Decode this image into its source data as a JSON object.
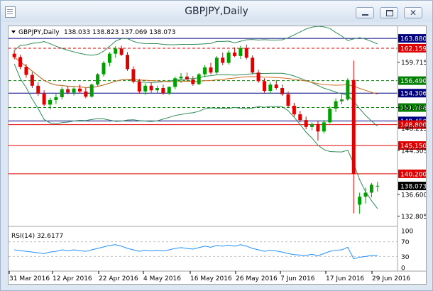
{
  "window": {
    "title": "GBPJPY,Daily",
    "icon": "chart-document-icon",
    "controls": {
      "minimize": "minimize-icon",
      "maximize": "maximize-icon",
      "close": "close-icon"
    },
    "close_glyph": "✕"
  },
  "chart_data": [
    {
      "type": "candlestick",
      "symbol": "GBPJPY,Daily",
      "ohlc_label": "138.033 138.823 137.069 138.073",
      "y_ticks": [
        "159.715",
        "151.784",
        "148.215",
        "144.305",
        "136.600",
        "132.805"
      ],
      "ylim": [
        131.0,
        166.0
      ],
      "x_ticks": [
        "31 Mar 2016",
        "12 Apr 2016",
        "22 Apr 2016",
        "4 May 2016",
        "16 May 2016",
        "26 May 2016",
        "7 Jun 2016",
        "17 Jun 2016",
        "29 Jun 2016"
      ],
      "horizontal_levels": [
        {
          "value": 163.88,
          "label": "163.880",
          "color": "#000080",
          "style": "solid"
        },
        {
          "value": 162.159,
          "label": "162.159",
          "color": "#e00000",
          "style": "dashed"
        },
        {
          "value": 156.49,
          "label": "156.490",
          "color": "#008000",
          "style": "dashed"
        },
        {
          "value": 154.306,
          "label": "154.306",
          "color": "#000080",
          "style": "solid"
        },
        {
          "value": 151.784,
          "label": "151.784",
          "color": "#008000",
          "style": "dashed"
        },
        {
          "value": 149.45,
          "label": "149.450",
          "color": "#000080",
          "style": "solid"
        },
        {
          "value": 148.8,
          "label": "148.800",
          "color": "#e00000",
          "style": "solid"
        },
        {
          "value": 145.15,
          "label": "145.150",
          "color": "#e00000",
          "style": "solid"
        },
        {
          "value": 140.2,
          "label": "140.200",
          "color": "#e00000",
          "style": "solid"
        }
      ],
      "current_price": {
        "value": 138.073,
        "label": "138.073"
      },
      "candles": [
        [
          161.2,
          161.8,
          160.2,
          160.6
        ],
        [
          160.6,
          161.0,
          158.5,
          158.9
        ],
        [
          158.9,
          159.4,
          157.0,
          157.5
        ],
        [
          157.5,
          158.0,
          155.2,
          155.6
        ],
        [
          155.6,
          156.2,
          153.8,
          154.2
        ],
        [
          154.2,
          154.8,
          152.0,
          152.3
        ],
        [
          152.3,
          153.5,
          151.5,
          153.1
        ],
        [
          153.1,
          154.2,
          152.4,
          153.6
        ],
        [
          153.6,
          155.4,
          153.2,
          155.0
        ],
        [
          155.0,
          155.6,
          154.1,
          154.4
        ],
        [
          154.4,
          155.3,
          153.9,
          155.1
        ],
        [
          155.1,
          155.8,
          154.3,
          154.6
        ],
        [
          154.6,
          155.2,
          153.4,
          153.7
        ],
        [
          153.7,
          156.0,
          153.5,
          155.8
        ],
        [
          155.8,
          157.8,
          155.5,
          157.6
        ],
        [
          157.6,
          159.9,
          157.2,
          159.6
        ],
        [
          159.6,
          161.5,
          159.0,
          161.2
        ],
        [
          161.2,
          162.5,
          160.5,
          162.1
        ],
        [
          162.1,
          162.6,
          160.8,
          161.0
        ],
        [
          161.0,
          161.5,
          158.2,
          158.5
        ],
        [
          158.5,
          159.0,
          156.0,
          156.3
        ],
        [
          156.3,
          156.8,
          154.2,
          154.6
        ],
        [
          154.6,
          156.0,
          154.0,
          155.6
        ],
        [
          155.6,
          156.2,
          154.4,
          154.8
        ],
        [
          154.8,
          155.6,
          154.2,
          155.2
        ],
        [
          155.2,
          155.8,
          154.0,
          154.3
        ],
        [
          154.3,
          155.5,
          154.0,
          155.4
        ],
        [
          155.4,
          157.2,
          155.0,
          156.9
        ],
        [
          156.9,
          157.8,
          156.1,
          157.2
        ],
        [
          157.2,
          157.9,
          156.4,
          156.7
        ],
        [
          156.7,
          157.3,
          155.6,
          155.9
        ],
        [
          155.9,
          157.8,
          155.7,
          157.6
        ],
        [
          157.6,
          159.2,
          157.1,
          158.8
        ],
        [
          158.8,
          159.6,
          157.6,
          157.9
        ],
        [
          157.9,
          160.8,
          157.6,
          160.5
        ],
        [
          160.5,
          161.4,
          159.2,
          159.6
        ],
        [
          159.6,
          161.8,
          159.3,
          161.4
        ],
        [
          161.4,
          162.3,
          160.6,
          160.8
        ],
        [
          160.8,
          162.6,
          160.3,
          162.2
        ],
        [
          162.2,
          162.8,
          160.2,
          160.5
        ],
        [
          160.5,
          160.9,
          157.6,
          157.9
        ],
        [
          157.9,
          158.4,
          156.1,
          156.4
        ],
        [
          156.4,
          156.9,
          154.4,
          154.7
        ],
        [
          154.7,
          156.2,
          154.2,
          155.8
        ],
        [
          155.8,
          156.6,
          154.9,
          155.2
        ],
        [
          155.2,
          155.8,
          153.8,
          154.1
        ],
        [
          154.1,
          154.6,
          151.8,
          152.1
        ],
        [
          152.1,
          152.6,
          150.2,
          150.6
        ],
        [
          150.6,
          151.2,
          149.2,
          149.6
        ],
        [
          149.6,
          150.2,
          148.0,
          148.4
        ],
        [
          148.4,
          149.2,
          147.8,
          148.9
        ],
        [
          148.9,
          149.4,
          146.0,
          147.6
        ],
        [
          147.6,
          149.6,
          147.3,
          149.2
        ],
        [
          149.2,
          152.0,
          149.0,
          151.6
        ],
        [
          151.6,
          153.4,
          151.0,
          152.9
        ],
        [
          152.9,
          154.0,
          152.4,
          153.2
        ],
        [
          153.2,
          156.9,
          153.0,
          156.6
        ],
        [
          156.6,
          160.0,
          133.3,
          140.2
        ],
        [
          134.8,
          136.9,
          133.2,
          136.2
        ],
        [
          136.2,
          137.8,
          135.0,
          136.9
        ],
        [
          136.9,
          138.6,
          136.1,
          138.3
        ],
        [
          138.0,
          138.8,
          137.1,
          138.1
        ]
      ],
      "indicators": {
        "rsi": {
          "label": "RSI(14) 32.6177",
          "levels": [
            "100",
            "70",
            "30",
            "0"
          ],
          "ylim": [
            0,
            100
          ],
          "values": [
            48,
            46,
            44,
            42,
            40,
            38,
            42,
            44,
            48,
            46,
            48,
            46,
            44,
            48,
            52,
            56,
            60,
            62,
            58,
            52,
            48,
            44,
            47,
            45,
            47,
            45,
            48,
            52,
            54,
            52,
            50,
            54,
            58,
            55,
            60,
            58,
            61,
            58,
            62,
            58,
            52,
            48,
            44,
            47,
            45,
            42,
            38,
            35,
            34,
            33,
            36,
            32,
            38,
            44,
            47,
            48,
            55,
            24,
            28,
            30,
            33,
            33
          ]
        }
      }
    }
  ]
}
